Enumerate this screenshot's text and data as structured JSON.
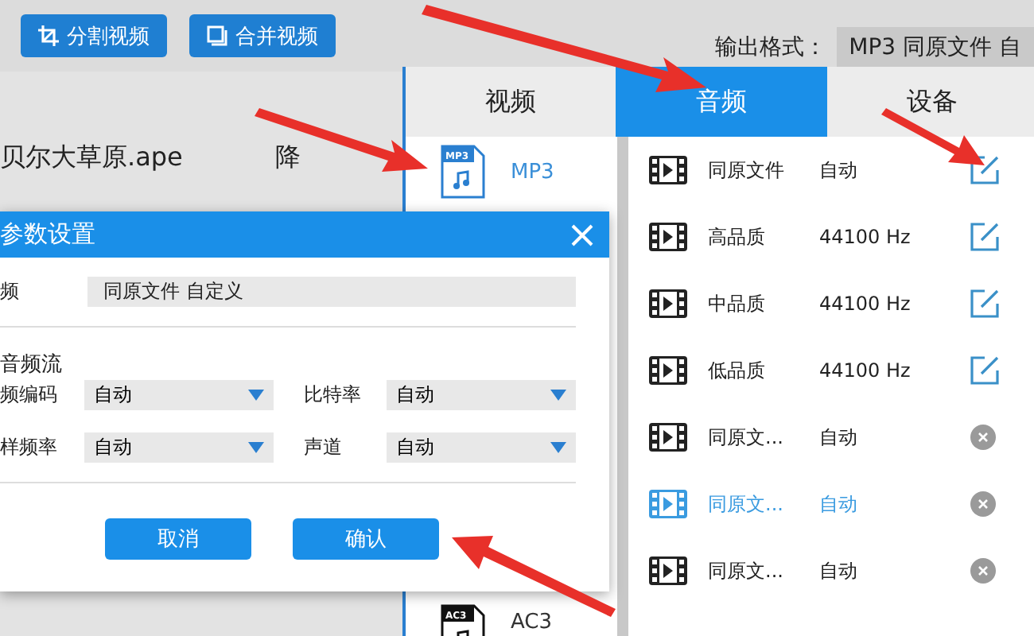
{
  "toolbar": {
    "buttons": [
      {
        "label": "分割视频"
      },
      {
        "label": "合并视频"
      }
    ],
    "output_format": {
      "label": "输出格式：",
      "value": "MP3  同原文件 自"
    }
  },
  "files": [
    {
      "name": "贝尔大草原.ape"
    },
    {
      "name": "降"
    }
  ],
  "format_panel": {
    "tabs": [
      {
        "label": "视频",
        "selected": false
      },
      {
        "label": "音频",
        "selected": true
      },
      {
        "label": "设备",
        "selected": false
      }
    ],
    "formats": [
      {
        "label": "MP3",
        "badge": "MP3",
        "selected": true
      },
      {
        "label": "AC3",
        "badge": "AC3",
        "selected": false
      }
    ],
    "presets": [
      {
        "kind": "builtin",
        "name": "同原文件",
        "value": "自动",
        "selected": false
      },
      {
        "kind": "builtin",
        "name": "高品质",
        "value": "44100 Hz",
        "selected": false
      },
      {
        "kind": "builtin",
        "name": "中品质",
        "value": "44100 Hz",
        "selected": false
      },
      {
        "kind": "builtin",
        "name": "低品质",
        "value": "44100 Hz",
        "selected": false
      },
      {
        "kind": "custom",
        "name": "同原文...",
        "value": "自动",
        "selected": false
      },
      {
        "kind": "custom",
        "name": "同原文...",
        "value": "自动",
        "selected": true
      },
      {
        "kind": "custom",
        "name": "同原文...",
        "value": "自动",
        "selected": false
      }
    ]
  },
  "dialog": {
    "title": "参数设置",
    "name_label": "频",
    "name_value": "同原文件 自定义",
    "section": "音频流",
    "selects": [
      {
        "label": "频编码",
        "value": "自动"
      },
      {
        "label": "比特率",
        "value": "自动"
      },
      {
        "label": "样频率",
        "value": "自动"
      },
      {
        "label": "声道",
        "value": "自动"
      }
    ],
    "buttons": [
      {
        "label": "取消"
      },
      {
        "label": "确认"
      }
    ]
  }
}
